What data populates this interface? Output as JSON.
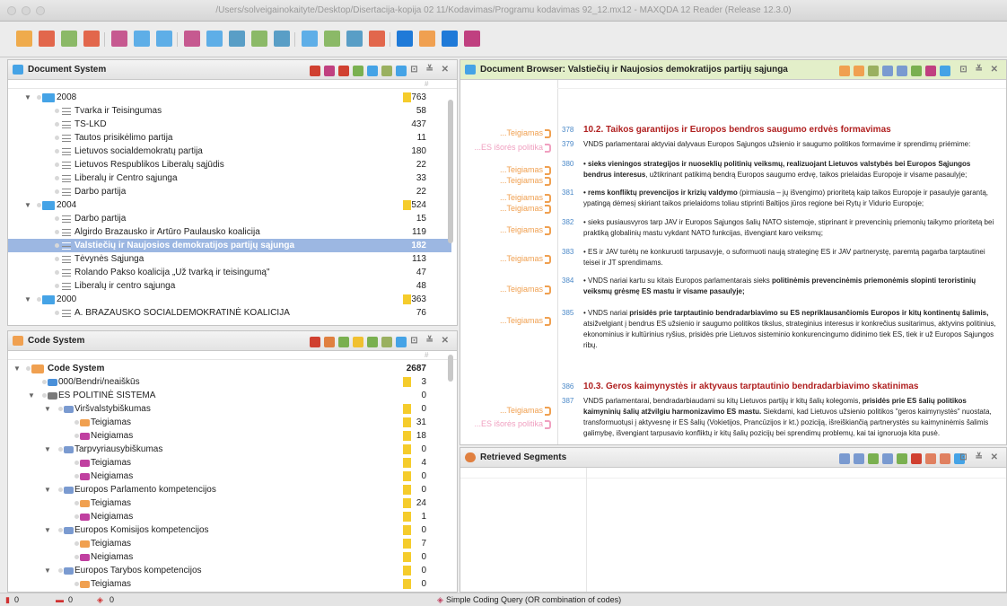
{
  "window": {
    "title": "/Users/solveigainokaityte/Desktop/Disertacija-kopija 02 11/Kodavimas/Programu kodavimas 92_12.mx12 - MAXQDA 12 Reader  (Release 12.3.0)"
  },
  "colors": {
    "accent_blue": "#45a3e6",
    "selection": "#9cb7e2",
    "memo_yellow": "#f5cc2c",
    "code_orange": "#f0a050",
    "code_red": "#c02020",
    "heading_green": "#e3efc9"
  },
  "document_system": {
    "title": "Document System",
    "col_hash": "#",
    "rows": [
      {
        "name": "2008",
        "count": "763",
        "type": "folder",
        "level": 0,
        "memo": true
      },
      {
        "name": "Tvarka ir Teisingumas",
        "count": "58",
        "type": "doc",
        "level": 1
      },
      {
        "name": "TS-LKD",
        "count": "437",
        "type": "doc",
        "level": 1
      },
      {
        "name": "Tautos prisikėlimo partija",
        "count": "11",
        "type": "doc",
        "level": 1
      },
      {
        "name": "Lietuvos socialdemokratų partija",
        "count": "180",
        "type": "doc",
        "level": 1
      },
      {
        "name": "Lietuvos Respublikos Liberalų sąjūdis",
        "count": "22",
        "type": "doc",
        "level": 1
      },
      {
        "name": "Liberalų ir Centro sąjunga",
        "count": "33",
        "type": "doc",
        "level": 1
      },
      {
        "name": "Darbo partija",
        "count": "22",
        "type": "doc",
        "level": 1
      },
      {
        "name": "2004",
        "count": "524",
        "type": "folder",
        "level": 0,
        "memo": true
      },
      {
        "name": "Darbo partija",
        "count": "15",
        "type": "doc",
        "level": 1
      },
      {
        "name": "Algirdo Brazausko ir Artūro Paulausko koalicija",
        "count": "119",
        "type": "doc",
        "level": 1
      },
      {
        "name": "Valstiečių ir Naujosios demokratijos partijų sąjunga",
        "count": "182",
        "type": "doc",
        "level": 1,
        "selected": true
      },
      {
        "name": "Tėvynės Sąjunga",
        "count": "113",
        "type": "doc",
        "level": 1
      },
      {
        "name": "Rolando Pakso koalicija „Už tvarką ir teisingumą\"",
        "count": "47",
        "type": "doc",
        "level": 1
      },
      {
        "name": "Liberalų ir centro sąjunga",
        "count": "48",
        "type": "doc",
        "level": 1
      },
      {
        "name": "2000",
        "count": "363",
        "type": "folder",
        "level": 0,
        "memo": true
      },
      {
        "name": "A. BRAZAUSKO SOCIALDEMOKRATINĖ KOALICIJA",
        "count": "76",
        "type": "doc",
        "level": 1
      }
    ]
  },
  "code_system": {
    "title": "Code System",
    "col_hash": "#",
    "rows": [
      {
        "name": "Code System",
        "count": "2687",
        "type": "root",
        "level": 0
      },
      {
        "name": "000/Bendri/neaiškūs",
        "count": "3",
        "level": 1,
        "color": "#4a90d9",
        "memo": true
      },
      {
        "name": "ES POLITINĖ SISTEMA",
        "count": "0",
        "level": 1,
        "color": "#7a7a7a",
        "expand": true
      },
      {
        "name": "Viršvalstybiškumas",
        "count": "0",
        "level": 2,
        "color": "#7a9ad0",
        "memo": true,
        "expand": true
      },
      {
        "name": "Teigiamas",
        "count": "31",
        "level": 3,
        "color": "#f0a050",
        "memo": true
      },
      {
        "name": "Neigiamas",
        "count": "18",
        "level": 3,
        "color": "#c040a0",
        "memo": true
      },
      {
        "name": "Tarpvyriausybiškumas",
        "count": "0",
        "level": 2,
        "color": "#7a9ad0",
        "memo": true,
        "expand": true
      },
      {
        "name": "Teigiamas",
        "count": "4",
        "level": 3,
        "color": "#c040a0",
        "memo": true
      },
      {
        "name": "Neigiamas",
        "count": "0",
        "level": 3,
        "color": "#c040a0",
        "memo": true
      },
      {
        "name": "Europos Parlamento kompetencijos",
        "count": "0",
        "level": 2,
        "color": "#7a9ad0",
        "memo": true,
        "expand": true
      },
      {
        "name": "Teigiamas",
        "count": "24",
        "level": 3,
        "color": "#f0a050",
        "memo": true
      },
      {
        "name": "Neigiamas",
        "count": "1",
        "level": 3,
        "color": "#c040a0",
        "memo": true
      },
      {
        "name": "Europos Komisijos kompetencijos",
        "count": "0",
        "level": 2,
        "color": "#7a9ad0",
        "memo": true,
        "expand": true
      },
      {
        "name": "Teigiamas",
        "count": "7",
        "level": 3,
        "color": "#f0a050",
        "memo": true
      },
      {
        "name": "Neigiamas",
        "count": "0",
        "level": 3,
        "color": "#c040a0",
        "memo": true
      },
      {
        "name": "Europos Tarybos kompetencijos",
        "count": "0",
        "level": 2,
        "color": "#7a9ad0",
        "memo": true,
        "expand": true
      },
      {
        "name": "Teigiamas",
        "count": "0",
        "level": 3,
        "color": "#f0a050",
        "memo": true
      }
    ]
  },
  "document_browser": {
    "title": "Document Browser: Valstiečių ir Naujosios demokratijos partijų sąjunga",
    "segments": [
      {
        "label": "...Teigiamas",
        "color": "#f0a050"
      },
      {
        "label": "...ES išorės politika",
        "color": "#f0a0c0"
      },
      {
        "label": "...Teigiamas",
        "color": "#f0a050"
      },
      {
        "label": "...Teigiamas",
        "color": "#f0a050"
      },
      {
        "label": "...Teigiamas",
        "color": "#f0a050"
      },
      {
        "label": "...Teigiamas",
        "color": "#f0a050"
      },
      {
        "label": "...Teigiamas",
        "color": "#f0a050"
      },
      {
        "label": "...Teigiamas",
        "color": "#f0a050"
      },
      {
        "label": "...Teigiamas",
        "color": "#f0a050"
      },
      {
        "label": "...Teigiamas",
        "color": "#f0a050"
      },
      {
        "label": "...Teigiamas",
        "color": "#f0a050"
      },
      {
        "label": "...ES išorės politika",
        "color": "#f0a0c0"
      }
    ],
    "paragraphs": [
      {
        "num": "378",
        "heading": true,
        "text": "10.2. Taikos garantijos ir Europos bendros saugumo erdvės formavimas"
      },
      {
        "num": "379",
        "text": "VNDS parlamentarai aktyviai dalyvaus Europos Sąjungos užsienio ir saugumo politikos formavime ir sprendimų priėmime:"
      },
      {
        "num": "380",
        "bold": "•  sieks vieningos strategijos ir nuoseklių politinių veiksmų, realizuojant Lietuvos valstybės bei Europos Sąjungos bendrus interesus",
        "text": ", užtikrinant patikimą bendrą Europos saugumo erdvę, taikos prielaidas Europoje ir visame pasaulyje;"
      },
      {
        "num": "381",
        "bold": "•  rems konfliktų prevencijos ir krizių valdymo",
        "text": " (pirmiausia – jų išvengimo) prioritetą kaip taikos Europoje ir pasaulyje garantą, ypatingą dėmesį skiriant taikos prielaidoms toliau stiprinti Baltijos jūros regione bei Rytų ir Vidurio Europoje;"
      },
      {
        "num": "382",
        "text": "•  sieks pusiausvyros tarp JAV ir Europos Sąjungos šalių NATO sistemoje, stiprinant ir prevencinių priemonių taikymo prioritetą bei praktiką globalinių mastu vykdant NATO funkcijas, išvengiant karo veiksmų;"
      },
      {
        "num": "383",
        "text": "•  ES ir JAV turėtų ne konkuruoti tarpusavyje, o suformuoti naują strateginę ES ir JAV partnerystę, paremtą pagarba tarptautinei teisei ir JT sprendimams."
      },
      {
        "num": "384",
        "text": "•  VNDS nariai kartu su kitais Europos parlamentarais sieks ",
        "bold2": "politinėmis prevencinėmis priemonėmis slopinti teroristinių veiksmų grėsmę ES mastu ir visame pasaulyje;"
      },
      {
        "num": "385",
        "text": "•  VNDS nariai ",
        "bold2": "prisidės prie tarptautinio bendradarbiavimo su ES nepriklausančiomis Europos ir kitų kontinentų šalimis,",
        "text2": " atsižvelgiant į bendrus ES užsienio ir saugumo politikos tikslus, strateginius interesus ir konkrečius susitarimus, aktyvins politinius, ekonominius ir kultūrinius ryšius, prisidės prie Lietuvos sisteminio konkurencingumo didinimo tiek ES, tiek ir už Europos Sąjungos ribų."
      },
      {
        "num": "386",
        "heading": true,
        "text": "10.3. Geros kaimynystės ir aktyvaus tarptautinio bendradarbiavimo skatinimas"
      },
      {
        "num": "387",
        "text": "VNDS parlamentarai, bendradarbiaudami su kitų Lietuvos partijų ir kitų šalių kolegomis, ",
        "bold2": "prisidės prie ES šalių politikos kaimyninių šalių atžvilgiu harmonizavimo ES mastu.",
        "text2": " Siekdami, kad Lietuvos užsienio politikos \"geros kaimynystės\" nuostata, transformuotųsi į aktyvesnę ir ES šalių (Vokietijos, Prancūzijos ir kt.) poziciją, išreiškiančią partnerystės su kaimyninėmis šalimis galimybę, išvengiant tarpusavio konfliktų ir kitų šalių pozicijų bei sprendimų problemų, kai tai ignoruoja kita pusė."
      }
    ]
  },
  "retrieved_segments": {
    "title": "Retrieved Segments"
  },
  "status": {
    "items": [
      "0",
      "0",
      "0"
    ],
    "query": "Simple Coding Query (OR combination of codes)"
  }
}
